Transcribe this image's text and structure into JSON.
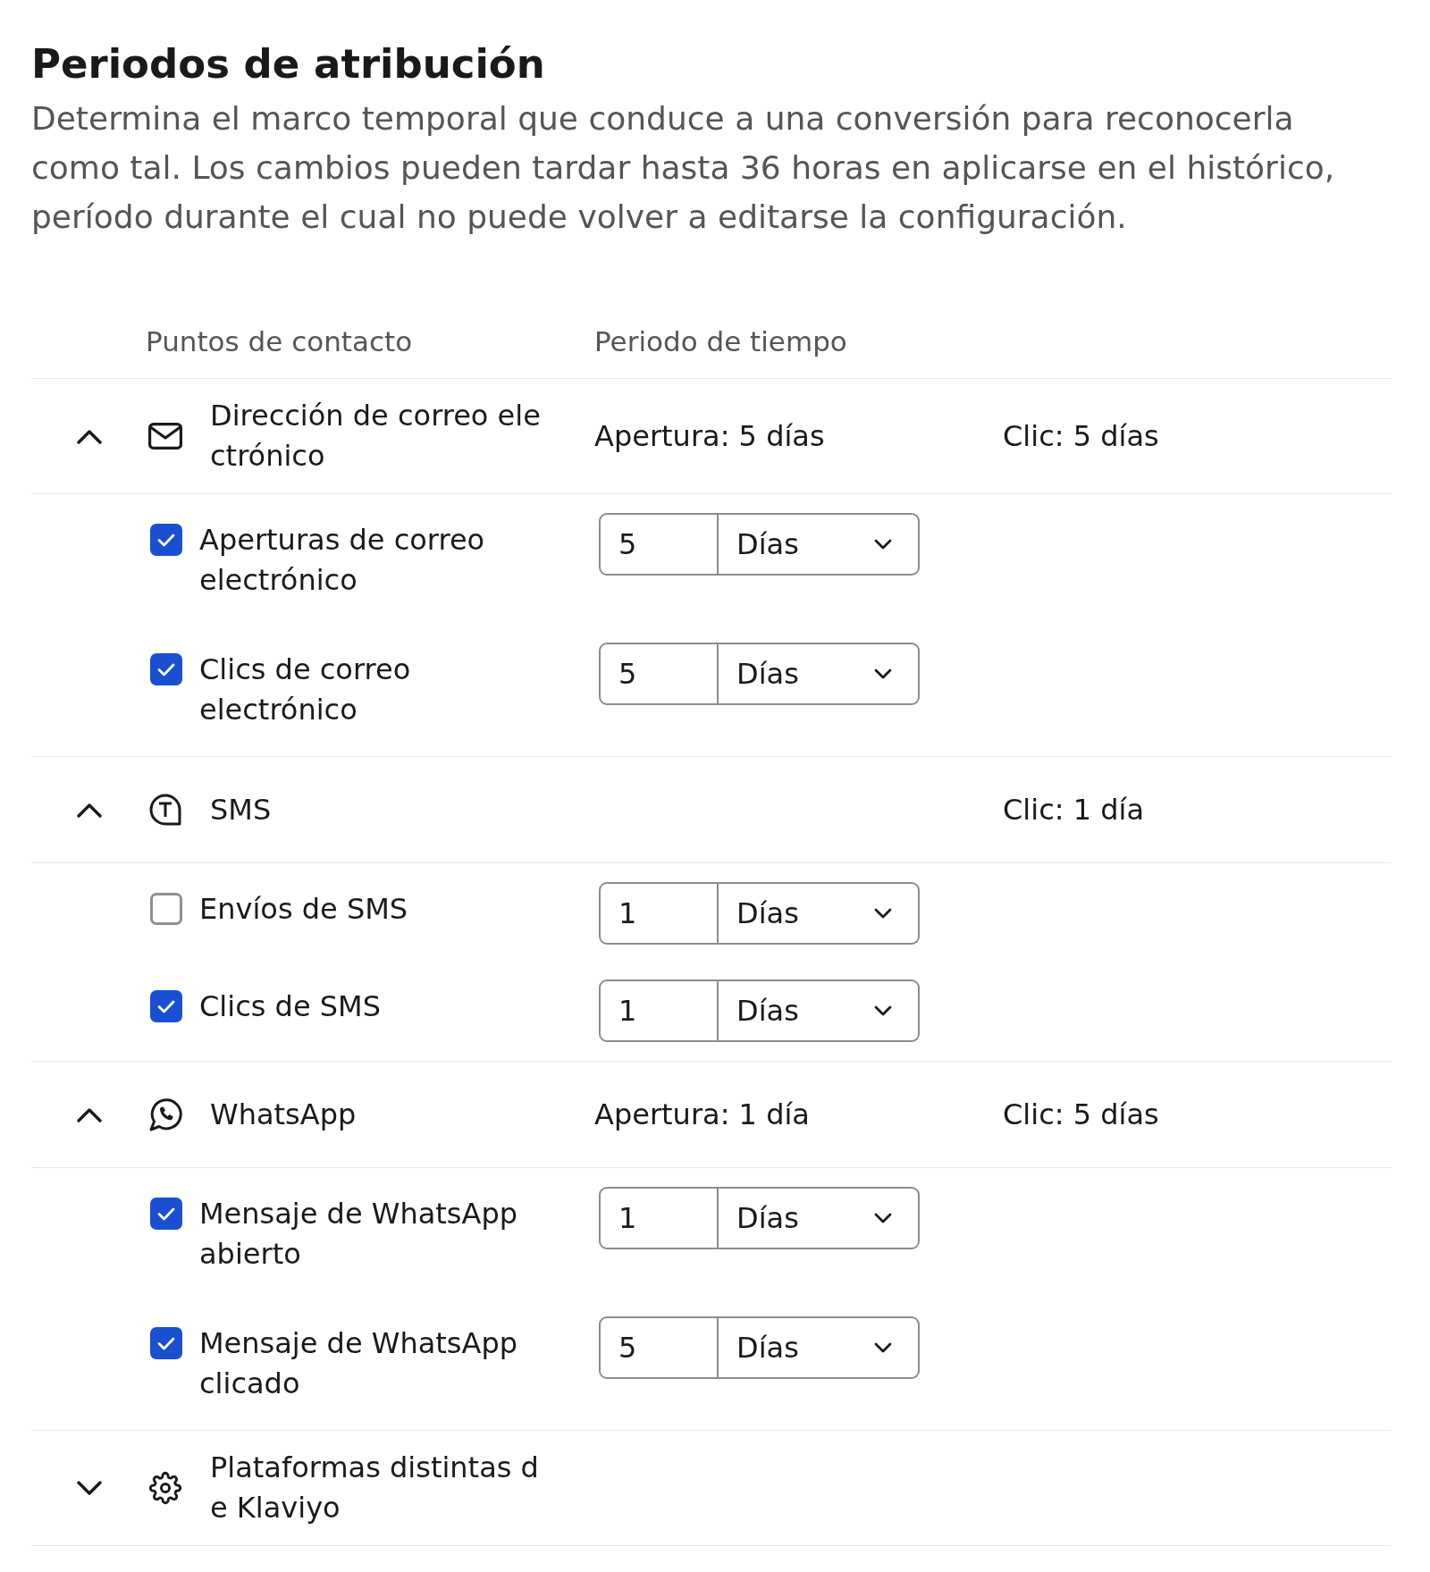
{
  "title": "Periodos de atribución",
  "description": "Determina el marco temporal que conduce a una conversión para reconocerla como tal. Los cambios pueden tardar hasta 36 horas en aplicarse en el histórico, período durante el cual no puede volver a editarse la configuración.",
  "table": {
    "columns": [
      "Puntos de contacto",
      "Periodo de tiempo"
    ],
    "groups": [
      {
        "kind": "email",
        "name": "Dirección de correo electrónico",
        "expanded": true,
        "open_period": "Apertura: 5 días",
        "click_period": "Clic: 5 días",
        "items": [
          {
            "label": "Aperturas de correo electrónico",
            "checked": true,
            "value": "5",
            "unit": "Días"
          },
          {
            "label": "Clics de correo electrónico",
            "checked": true,
            "value": "5",
            "unit": "Días"
          }
        ]
      },
      {
        "kind": "sms",
        "name": "SMS",
        "expanded": true,
        "click_period": "Clic: 1 día",
        "items": [
          {
            "label": "Envíos de SMS",
            "checked": false,
            "value": "1",
            "unit": "Días"
          },
          {
            "label": "Clics de SMS",
            "checked": true,
            "value": "1",
            "unit": "Días"
          }
        ]
      },
      {
        "kind": "whatsapp",
        "name": "WhatsApp",
        "expanded": true,
        "open_period": "Apertura: 1 día",
        "click_period": "Clic: 5 días",
        "items": [
          {
            "label": "Mensaje de WhatsApp abierto",
            "checked": true,
            "value": "1",
            "unit": "Días"
          },
          {
            "label": "Mensaje de WhatsApp clicado",
            "checked": true,
            "value": "5",
            "unit": "Días"
          }
        ]
      },
      {
        "kind": "other",
        "name": "Plataformas distintas de Klaviyo",
        "expanded": false
      }
    ]
  }
}
